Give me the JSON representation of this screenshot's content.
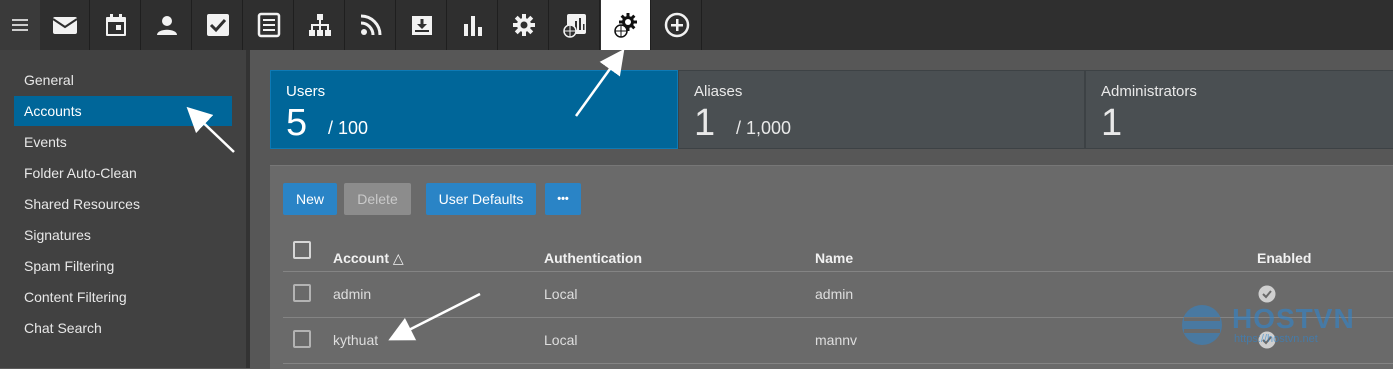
{
  "toolbar": {
    "menu_icon": "hamburger-icon",
    "icons": [
      "mail-icon",
      "calendar-icon",
      "contacts-icon",
      "tasks-icon",
      "notes-icon",
      "org-chart-icon",
      "rss-icon",
      "download-icon",
      "bar-chart-icon",
      "gear-icon",
      "domain-reports-icon",
      "domain-settings-icon",
      "add-circle-icon"
    ],
    "active_icon": "domain-settings-icon"
  },
  "sidebar": {
    "items": [
      {
        "label": "General"
      },
      {
        "label": "Accounts",
        "active": true
      },
      {
        "label": "Events"
      },
      {
        "label": "Folder Auto-Clean"
      },
      {
        "label": "Shared Resources"
      },
      {
        "label": "Signatures"
      },
      {
        "label": "Spam Filtering"
      },
      {
        "label": "Content Filtering"
      },
      {
        "label": "Chat Search"
      }
    ]
  },
  "summary": {
    "users": {
      "label": "Users",
      "count": "5",
      "limit": "/ 100"
    },
    "aliases": {
      "label": "Aliases",
      "count": "1",
      "limit": "/ 1,000"
    },
    "administrators": {
      "label": "Administrators",
      "count": "1"
    }
  },
  "actions": {
    "new_label": "New",
    "delete_label": "Delete",
    "user_defaults_label": "User Defaults",
    "more_label": "•••"
  },
  "table": {
    "headers": {
      "account": "Account △",
      "authentication": "Authentication",
      "name": "Name",
      "enabled": "Enabled"
    },
    "rows": [
      {
        "account": "admin",
        "authentication": "Local",
        "name": "admin",
        "enabled": true
      },
      {
        "account": "kythuat",
        "authentication": "Local",
        "name": "mannv",
        "enabled": true
      }
    ]
  },
  "watermark": {
    "brand": "HOSTVN",
    "site": "https://hostvn.net"
  },
  "colors": {
    "accent": "#006699",
    "button": "#2a84c6",
    "toolbar": "#2f2f2f",
    "sidebar": "#414141"
  }
}
